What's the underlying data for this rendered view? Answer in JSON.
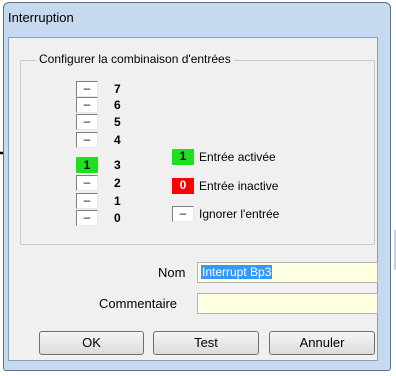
{
  "window": {
    "title": "Interruption"
  },
  "group": {
    "label": "Configurer la combinaison d'entrées",
    "bits": [
      {
        "num": "7",
        "state": "–",
        "active": false
      },
      {
        "num": "6",
        "state": "–",
        "active": false
      },
      {
        "num": "5",
        "state": "–",
        "active": false
      },
      {
        "num": "4",
        "state": "–",
        "active": false
      },
      {
        "num": "3",
        "state": "1",
        "active": true
      },
      {
        "num": "2",
        "state": "–",
        "active": false
      },
      {
        "num": "1",
        "state": "–",
        "active": false
      },
      {
        "num": "0",
        "state": "–",
        "active": false
      }
    ]
  },
  "legend": {
    "active": {
      "symbol": "1",
      "label": "Entrée activée",
      "color": "#1ee01e"
    },
    "inactive": {
      "symbol": "0",
      "label": "Entrée inactive",
      "color": "#ff0000"
    },
    "ignore": {
      "symbol": "–",
      "label": "Ignorer l'entrée"
    }
  },
  "form": {
    "nom_label": "Nom",
    "nom_value": "Interrupt Bp3",
    "commentaire_label": "Commentaire",
    "commentaire_value": ""
  },
  "buttons": {
    "ok": "OK",
    "test": "Test",
    "annuler": "Annuler"
  },
  "colors": {
    "window_frame": "#c6d9ee",
    "field_bg": "#fefee1",
    "selection": "#3399ff"
  }
}
